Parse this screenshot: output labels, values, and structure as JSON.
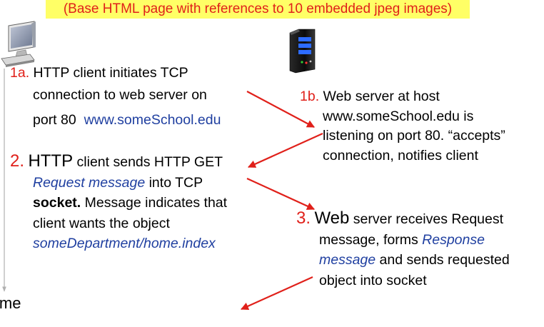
{
  "banner": "(Base HTML page with references to 10 embedded jpeg images)",
  "time_label": "ime",
  "step_1a": {
    "num": "1a.",
    "line1": "HTTP client initiates TCP",
    "line2": "connection to web server on",
    "line3_prefix": "port 80",
    "host": "www.someSchool.edu"
  },
  "step_1b": {
    "num": "1b.",
    "line1": "Web server at host",
    "line2": "www.someSchool.edu is",
    "line3": "listening on port 80. “accepts”",
    "line4": "connection, notifies client"
  },
  "step_2": {
    "num": "2.",
    "http": "HTTP",
    "line1_rest": "client sends HTTP GET",
    "line2_italic": "Request message",
    "line2_rest": "into TCP",
    "line3_bold": "socket.",
    "line3_rest": "Message indicates that",
    "line4": "client wants the object",
    "line5_italic": "someDepartment/home.index"
  },
  "step_3": {
    "num": "3.",
    "web": "Web",
    "line1_rest": "server receives Request",
    "line2_prefix": "message, forms",
    "line2_italic": "Response",
    "line3_italic": "message",
    "line3_rest": "and sends requested",
    "line4": "object into socket"
  },
  "colors": {
    "step_number": "#e0201a",
    "arrow": "#e0201a",
    "highlight": "#ffff66",
    "link_text": "#1f3fa0",
    "timeline": "#b0b0b0"
  },
  "icons": {
    "client": "desktop-computer-icon",
    "server": "server-tower-icon"
  }
}
